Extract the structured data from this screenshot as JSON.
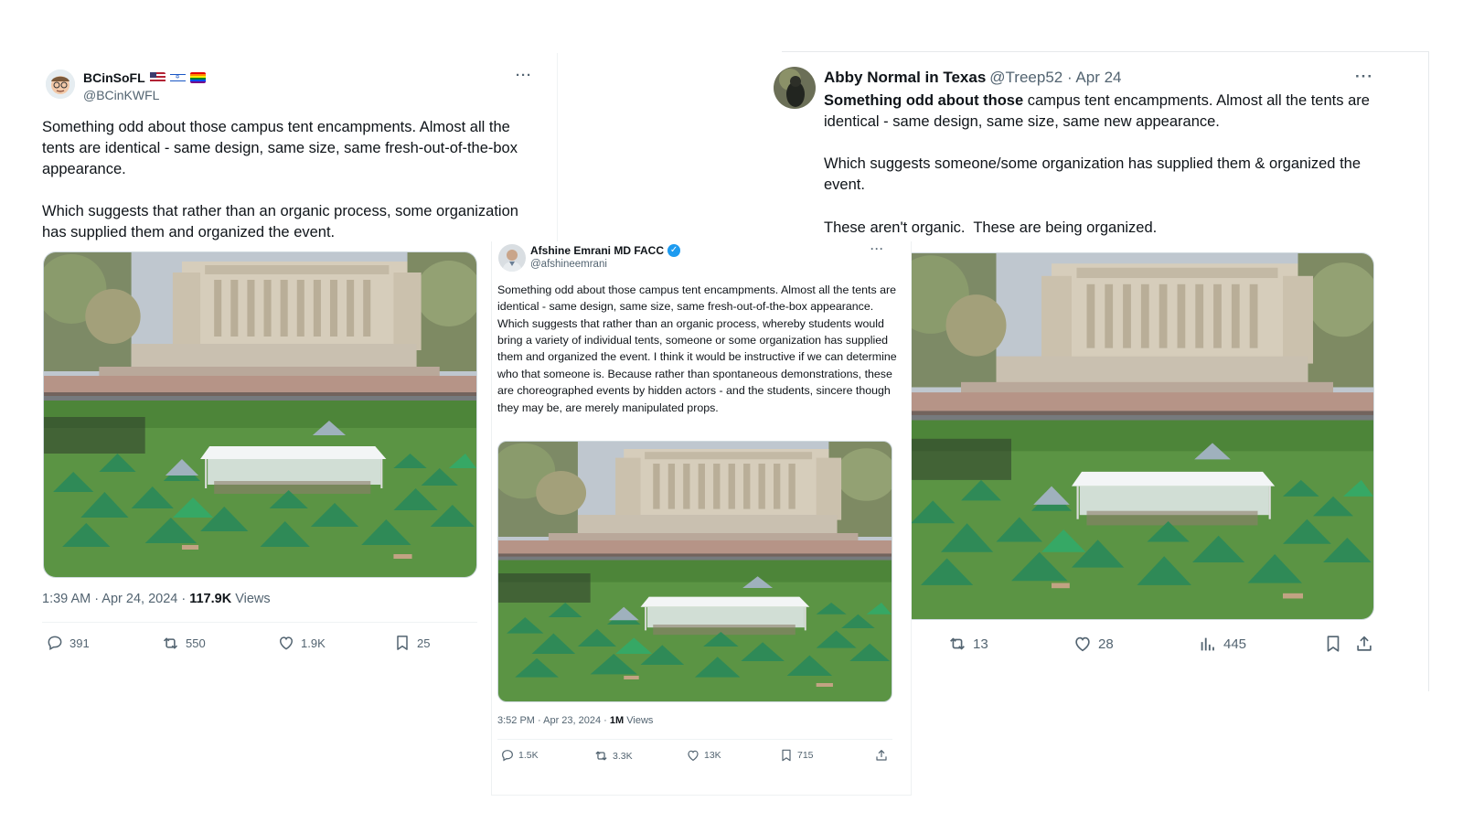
{
  "tweet_left": {
    "display_name": "BCinSoFL",
    "handle": "@BCinKWFL",
    "menu": "···",
    "text": "Something odd about those campus tent encampments. Almost all the tents are identical - same design, same size, same fresh-out-of-the-box appearance.\n\nWhich suggests that rather than an organic process, some organization has supplied them and organized the event.",
    "time": "1:39 AM · Apr 24, 2024 · ",
    "views_count": "117.9K",
    "views_label": " Views",
    "replies": "391",
    "reposts": "550",
    "likes": "1.9K",
    "bookmarks": "25"
  },
  "tweet_middle": {
    "display_name": "Afshine Emrani MD FACC",
    "handle": "@afshineemrani",
    "menu": "···",
    "text": "Something odd about those campus tent encampments. Almost all the tents are identical - same design, same size, same fresh-out-of-the-box appearance. Which suggests that rather than an organic process, whereby students would bring a variety of individual tents, someone or some organization has supplied them and organized the event. I think it would be instructive if we can determine who that someone is. Because rather than spontaneous demonstrations, these are choreographed events by hidden actors - and the students, sincere though they may be, are merely manipulated props.",
    "time": "3:52 PM · Apr 23, 2024 · ",
    "views_count": "1M",
    "views_label": " Views",
    "replies": "1.5K",
    "reposts": "3.3K",
    "likes": "13K",
    "bookmarks": "715"
  },
  "tweet_right": {
    "display_name": "Abby Normal in Texas",
    "handle": "@Treep52 · Apr 24",
    "menu": "···",
    "text_bold": "Something odd about those",
    "text_rest": " campus tent encampments. Almost all the tents are identical - same design, same size, same new appearance.\n\nWhich suggests someone/some organization has supplied them & organized the event.\n\nThese aren't organic.  These are being organized.",
    "reposts": "13",
    "likes": "28",
    "views": "445"
  },
  "colors": {
    "text": "#0f1419",
    "muted": "#536471",
    "verified": "#1d9bf0",
    "grass": "#4f8a3c",
    "tent": "#2f8a57"
  }
}
